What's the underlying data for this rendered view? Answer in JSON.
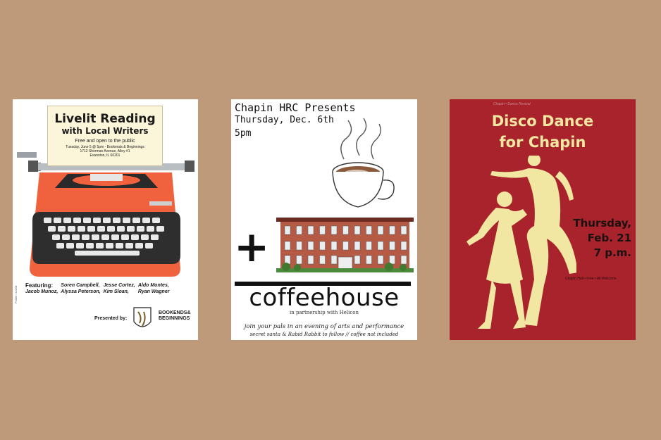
{
  "poster1": {
    "title": "Livelit Reading",
    "subtitle": "with Local Writers",
    "free": "Free and open to the public",
    "when": "Tuesday, June 5 @ 5pm - Bookends & Beginnings",
    "address1": "1712 Sherman Avenue, Alley #1",
    "address2": "Evanston, IL 60201",
    "featuring_label": "Featuring:",
    "writers": [
      "Soren Campbell,",
      "Jesse Cortez,",
      "Aldo Montes,",
      "Jacob Munoz,",
      "Alyssa Peterson,",
      "Kim Sloan,",
      "Ryan Wagner"
    ],
    "presented_by": "Presented by:",
    "bookends_1": "BOOKENDS&",
    "bookends_2": "BEGINNINGS",
    "side_text": "Poster • Livelit",
    "colors": {
      "typewriter": "#f0623e",
      "keys": "#2e2e2e",
      "paper": "#fbf6d9"
    }
  },
  "poster2": {
    "line1": "Chapin HRC Presents",
    "line2": "Thursday, Dec. 6th",
    "line3": "5pm",
    "plus": "+",
    "coffeehouse": "coffeehouse",
    "partnership": "in partnership with Helicon",
    "join": "join your pals in an evening of arts and performance",
    "secret": "secret santa & Rabid Rabbit to follow // coffee not included"
  },
  "poster3": {
    "top_small": "Chapin • Dance Revival",
    "title1": "Disco Dance",
    "title2": "for Chapin",
    "date1": "Thursday,",
    "date2": "Feb. 21",
    "date3": "7 p.m.",
    "bottom_small": "Chapin Hall • Free • All Welcome",
    "colors": {
      "background": "#a8232b",
      "accent": "#f1e7a2"
    }
  }
}
